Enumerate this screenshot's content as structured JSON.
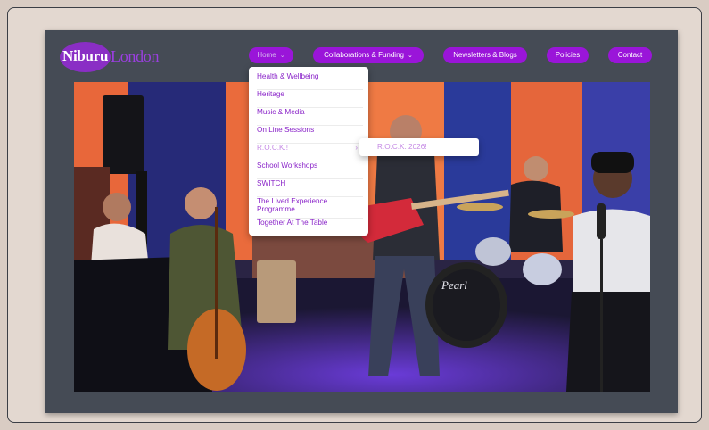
{
  "brand": {
    "logo_part1": "Niburu",
    "logo_part2": "London",
    "accent_color": "#9a15d9"
  },
  "nav": {
    "home": "Home",
    "collaborations": "Collaborations & Funding",
    "newsletters": "Newsletters & Blogs",
    "policies": "Policies",
    "contact": "Contact"
  },
  "dropdown": {
    "items": [
      "Health & Wellbeing",
      "Heritage",
      "Music & Media",
      "On Line Sessions",
      "R.O.C.K.!",
      "School Workshops",
      "SWITCH",
      "The Lived Experience Programme",
      "Together At The Table"
    ],
    "submenu": [
      "R.O.C.K. 2026!"
    ]
  },
  "hero": {
    "drum_brand": "Pearl"
  }
}
